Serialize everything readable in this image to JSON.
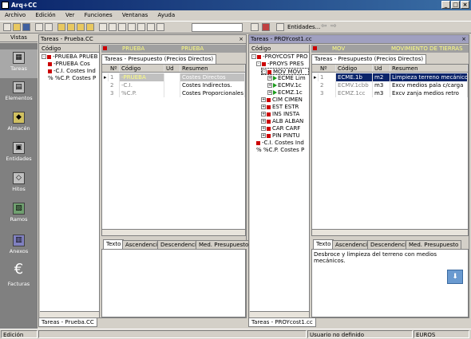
{
  "app": {
    "title": "Arq+CC"
  },
  "menu": [
    "Archivo",
    "Edición",
    "Ver",
    "Funciones",
    "Ventanas",
    "Ayuda"
  ],
  "toolbar": {
    "entidades_label": "Entidades..."
  },
  "vistas": {
    "header": "Vistas",
    "items": [
      "Tareas",
      "Elementos",
      "Almacén",
      "Entidades",
      "Hitos",
      "Ramos",
      "Anexos",
      "Facturas"
    ]
  },
  "left": {
    "title": "Tareas - Prueba.CC",
    "tree_header": "Código",
    "tree": [
      {
        "text": "-PRUEBA  PRUEB"
      },
      {
        "text": "-PRUEBA  Cos"
      },
      {
        "text": "-C.I.  Costes Ind"
      },
      {
        "text": "%  %C.P.  Costes P"
      }
    ],
    "top_row": {
      "code": "PRUEBA",
      "name": "PRUEBA"
    },
    "tab_label": "Tareas - Presupuesto (Precios Directos)",
    "grid_headers": [
      "Nº",
      "Código",
      "Ud",
      "Resumen"
    ],
    "grid_rows": [
      {
        "n": "1",
        "code": "-PRUEBA",
        "ud": "",
        "res": "Costes Directos"
      },
      {
        "n": "2",
        "code": "-C.I.",
        "ud": "",
        "res": "Costes Indirectos."
      },
      {
        "n": "3",
        "code": "%C.P.",
        "ud": "",
        "res": "Costes Proporcionales"
      }
    ],
    "bottom_tabs": [
      "Texto",
      "Ascendencia",
      "Descendencia",
      "Med. Presupuesto"
    ],
    "bottom_text": "",
    "doc_tab": "Tareas - Prueba.CC"
  },
  "right": {
    "title": "Tareas - PROYcost1.cc",
    "tree_header": "Código",
    "tree": [
      {
        "text": "-PROYCOST  PRO",
        "indent": 0,
        "kind": "pm"
      },
      {
        "text": "-PROYS  PRES",
        "indent": 1,
        "kind": "pm"
      },
      {
        "text": "MOV  MOVI",
        "indent": 2,
        "kind": "pm",
        "sel": true
      },
      {
        "text": "ECME  Lim",
        "indent": 3,
        "kind": "tri"
      },
      {
        "text": "ECMV.1c",
        "indent": 3,
        "kind": "tri"
      },
      {
        "text": "ECMZ.1c",
        "indent": 3,
        "kind": "tri"
      },
      {
        "text": "CIM  CIMEN",
        "indent": 2,
        "kind": "pm"
      },
      {
        "text": "EST  ESTR",
        "indent": 2,
        "kind": "pm"
      },
      {
        "text": "INS  INSTA",
        "indent": 2,
        "kind": "pm"
      },
      {
        "text": "ALB  ALBAÑ",
        "indent": 2,
        "kind": "pm"
      },
      {
        "text": "CAR  CARF",
        "indent": 2,
        "kind": "pm"
      },
      {
        "text": "PIN  PINTU",
        "indent": 2,
        "kind": "pm"
      },
      {
        "text": "-C.I.  Costes Ind",
        "indent": 1,
        "kind": "sq"
      },
      {
        "text": "%  %C.P.  Costes P",
        "indent": 1,
        "kind": "none"
      }
    ],
    "top_row": {
      "code": "MOV",
      "name": "MOVIMIENTO DE TIERRAS"
    },
    "tab_label": "Tareas - Presupuesto (Precios Directos)",
    "grid_headers": [
      "Nº",
      "Código",
      "Ud",
      "Resumen"
    ],
    "grid_rows": [
      {
        "n": "1",
        "code": "ECME.1b",
        "ud": "m2",
        "res": "Limpieza terreno mecánico"
      },
      {
        "n": "2",
        "code": "ECMV.1cbb",
        "ud": "m3",
        "res": "Excv medios pala c/carga"
      },
      {
        "n": "3",
        "code": "ECMZ.1cc",
        "ud": "m3",
        "res": "Excv zanja medios retro"
      }
    ],
    "bottom_tabs": [
      "Texto",
      "Ascendencia",
      "Descendencia",
      "Med. Presupuesto"
    ],
    "bottom_text": "Desbroce y limpieza del terreno con medios mecánicos.",
    "doc_tab": "Tareas - PROYcost1.cc"
  },
  "status": {
    "mode": "Edición",
    "user": "Usuario no definido",
    "currency": "EUROS"
  }
}
